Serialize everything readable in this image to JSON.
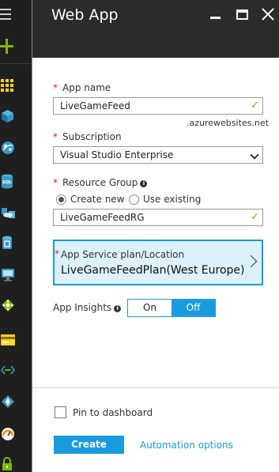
{
  "app": {
    "blade_title": "Web App"
  },
  "form": {
    "app_name": {
      "label": "App name",
      "value": "LiveGameFeed",
      "suffix": ".azurewebsites.net"
    },
    "subscription": {
      "label": "Subscription",
      "value": "Visual Studio Enterprise"
    },
    "resource_group": {
      "label": "Resource Group",
      "options": [
        "Create new",
        "Use existing"
      ],
      "selected": "Create new",
      "value": "LiveGameFeedRG"
    },
    "service_plan": {
      "label": "App Service plan/Location",
      "value": "LiveGameFeedPlan(West Europe)"
    },
    "app_insights": {
      "label": "App Insights",
      "on_label": "On",
      "off_label": "Off",
      "selected": "Off"
    }
  },
  "footer": {
    "pin_label": "Pin to dashboard",
    "pin_checked": false,
    "create_label": "Create",
    "automation_label": "Automation options"
  },
  "colors": {
    "accent": "#1a9be0",
    "valid": "#7fba00",
    "required": "#e81123",
    "header_bg": "#2b2b2b"
  },
  "rail_icons": [
    "hamburger-menu-icon",
    "new-plus-icon",
    "dashboard-grid-icon",
    "resource-cube-icon",
    "app-services-icon",
    "sql-database-icon",
    "cloud-services-icon",
    "storage-icon",
    "virtual-machine-icon",
    "service-fabric-icon",
    "subscriptions-card-icon",
    "virtual-network-icon",
    "monitor-diamond-icon",
    "advisor-gauge-icon",
    "security-lock-icon"
  ]
}
